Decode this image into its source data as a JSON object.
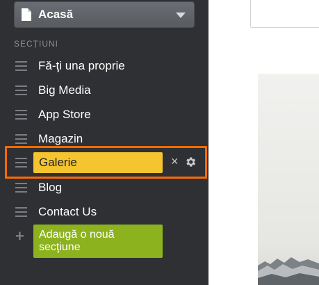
{
  "page_select": {
    "label": "Acasă"
  },
  "sidebar": {
    "heading": "SECȚIUNI",
    "items": [
      {
        "label": "Fă-ţi una proprie"
      },
      {
        "label": "Big Media"
      },
      {
        "label": "App Store"
      },
      {
        "label": "Magazin"
      },
      {
        "label": "Galerie",
        "editing": true
      },
      {
        "label": "Blog"
      },
      {
        "label": "Contact Us"
      }
    ],
    "add_button": "Adaugă o nouă secţiune"
  },
  "colors": {
    "sidebar_bg": "#2f3033",
    "highlight_border": "#ff6a00",
    "edit_input_bg": "#f4c52f",
    "add_button_bg": "#8cb21e"
  }
}
